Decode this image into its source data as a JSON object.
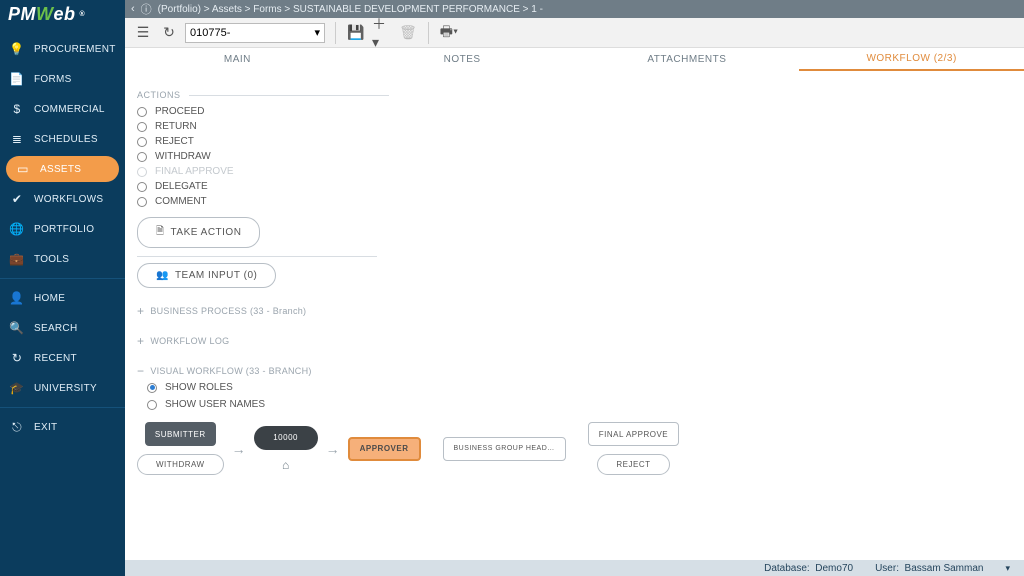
{
  "brand": {
    "p1": "PM",
    "p2": "W",
    "p3": "eb"
  },
  "breadcrumb": [
    "(Portfolio)",
    "Assets",
    "Forms",
    "SUSTAINABLE DEVELOPMENT PERFORMANCE",
    "1 -"
  ],
  "toolbar": {
    "record": "010775-"
  },
  "sidebar": {
    "items": [
      {
        "label": "PROCUREMENT",
        "icon": "💡",
        "name": "procurement"
      },
      {
        "label": "FORMS",
        "icon": "📄",
        "name": "forms"
      },
      {
        "label": "COMMERCIAL",
        "icon": "$",
        "name": "commercial"
      },
      {
        "label": "SCHEDULES",
        "icon": "≣",
        "name": "schedules"
      },
      {
        "label": "ASSETS",
        "icon": "▭",
        "name": "assets",
        "active": true
      },
      {
        "label": "WORKFLOWS",
        "icon": "✔",
        "name": "workflows"
      },
      {
        "label": "PORTFOLIO",
        "icon": "🌐",
        "name": "portfolio"
      },
      {
        "label": "TOOLS",
        "icon": "💼",
        "name": "tools"
      }
    ],
    "items2": [
      {
        "label": "HOME",
        "icon": "👤",
        "name": "home"
      },
      {
        "label": "SEARCH",
        "icon": "🔍",
        "name": "search"
      },
      {
        "label": "RECENT",
        "icon": "↻",
        "name": "recent"
      },
      {
        "label": "UNIVERSITY",
        "icon": "🎓",
        "name": "university"
      }
    ],
    "items3": [
      {
        "label": "EXIT",
        "icon": "⎋",
        "name": "exit"
      }
    ]
  },
  "tabs": [
    {
      "label": "MAIN",
      "name": "main"
    },
    {
      "label": "NOTES",
      "name": "notes"
    },
    {
      "label": "ATTACHMENTS",
      "name": "attachments"
    },
    {
      "label": "WORKFLOW (2/3)",
      "name": "workflow",
      "active": true
    }
  ],
  "actions": {
    "header": "ACTIONS",
    "options": [
      {
        "label": "PROCEED",
        "name": "proceed",
        "disabled": false
      },
      {
        "label": "RETURN",
        "name": "return",
        "disabled": false
      },
      {
        "label": "REJECT",
        "name": "reject",
        "disabled": false
      },
      {
        "label": "WITHDRAW",
        "name": "withdraw",
        "disabled": false
      },
      {
        "label": "FINAL APPROVE",
        "name": "final-approve",
        "disabled": true
      },
      {
        "label": "DELEGATE",
        "name": "delegate",
        "disabled": false
      },
      {
        "label": "COMMENT",
        "name": "comment",
        "disabled": false
      }
    ],
    "take_action": "TAKE ACTION",
    "team_input": "TEAM INPUT (0)"
  },
  "collapsibles": {
    "bp": "BUSINESS PROCESS (33 - Branch)",
    "wl": "WORKFLOW LOG",
    "vw": "VISUAL WORKFLOW (33 - BRANCH)"
  },
  "visual_workflow": {
    "show_roles": "SHOW ROLES",
    "show_user_names": "SHOW USER NAMES",
    "selected": "roles",
    "nodes": {
      "submitter": "SUBMITTER",
      "withdraw": "WITHDRAW",
      "step": "10000",
      "approver": "APPROVER",
      "bgh": "BUSINESS GROUP HEAD…",
      "final": "FINAL APPROVE",
      "reject": "REJECT"
    }
  },
  "footer": {
    "db_label": "Database:",
    "db": "Demo70",
    "user_label": "User:",
    "user": "Bassam Samman"
  }
}
